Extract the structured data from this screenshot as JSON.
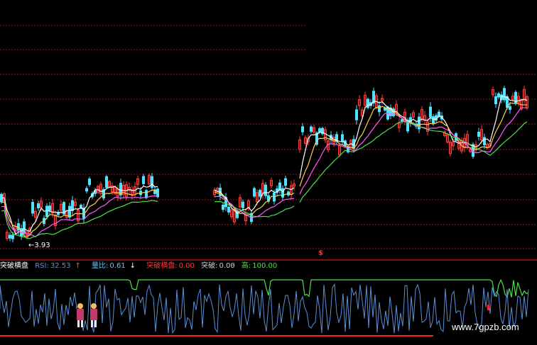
{
  "indicator": {
    "name": "突破横盘",
    "rsi_label": "RSI:",
    "rsi_value": "32.53",
    "rsi_arrow": "↑",
    "volume_ratio_label": "量比:",
    "volume_ratio_value": "0.61",
    "volume_ratio_arrow": "↓",
    "breakout_flat_label": "突破横盘:",
    "breakout_flat_value": "0.00",
    "breakout_label": "突破:",
    "breakout_value": "0.00",
    "high_label": "高:",
    "high_value": "100.00",
    "cursor_mark": "-"
  },
  "main_chart": {
    "low_price_label": "←3.93",
    "signal_mark": "$"
  },
  "watermark": "www.7gpzb.com",
  "colors": {
    "background": "#000000",
    "up_candle": "#ff3c3c",
    "down_candle": "#4fe3ff",
    "ma_short": "#ffffff",
    "ma_mid": "#ffd24a",
    "ma_long": "#ff5aff",
    "ma_longer": "#4de04d",
    "rsi_line": "#5a8fd8",
    "high_line": "#4de04d",
    "grid": "#a01010",
    "baseline": "#ff2020",
    "label_name": "#ffffff",
    "label_rsi": "#5a8fd8",
    "label_ratio": "#5ac8ff",
    "label_breakout_flat": "#ff3c3c",
    "label_breakout": "#cfcfcf",
    "label_high": "#4de04d"
  }
}
